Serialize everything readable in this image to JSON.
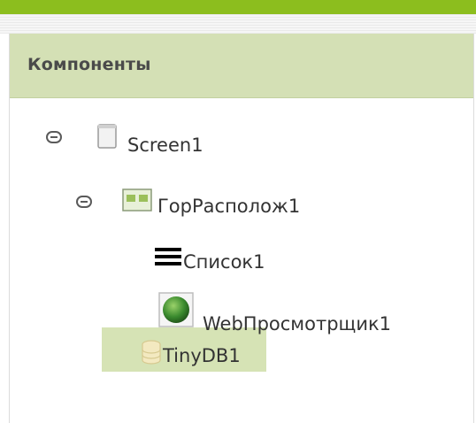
{
  "panel": {
    "title": "Компоненты"
  },
  "tree": {
    "screen": {
      "label": "Screen1",
      "icon": "screen-icon",
      "expanded": true
    },
    "arrangement": {
      "label": "ГорРасполож1",
      "icon": "horizontal-arrangement-icon",
      "expanded": true
    },
    "list": {
      "label": "Список1",
      "icon": "listview-icon"
    },
    "web": {
      "label": "WebПросмотрщик1",
      "icon": "webviewer-globe-icon"
    },
    "db": {
      "label": "TinyDB1",
      "icon": "tinydb-database-icon",
      "selected": true
    }
  },
  "colors": {
    "accent_bar": "#8cbe1e",
    "header_bg": "#d4e0b5",
    "selected_bg": "#d6e3b5"
  }
}
